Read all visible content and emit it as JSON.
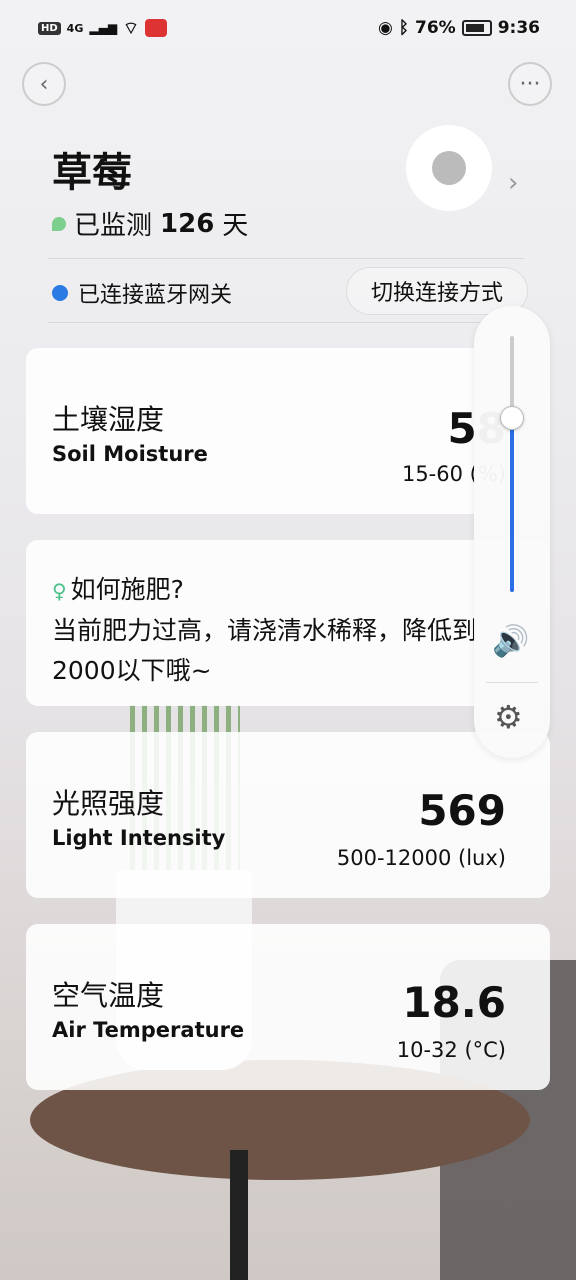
{
  "status_bar": {
    "left_chip": "HD",
    "network": "4G",
    "battery_pct": "76%",
    "time": "9:36"
  },
  "header": {
    "plant_name": "草莓",
    "monitored_prefix": "已监测",
    "monitored_days": "126",
    "days_unit": "天"
  },
  "connection": {
    "status": "已连接蓝牙网关",
    "switch_label": "切换连接方式"
  },
  "soil": {
    "cn": "土壤湿度",
    "en": "Soil Moisture",
    "value": "58",
    "range": "15-60 (%)"
  },
  "tip": {
    "title": "如何施肥?",
    "text": "当前肥力过高，请浇清水稀释，降低到2000以下哦~"
  },
  "light": {
    "cn": "光照强度",
    "en": "Light Intensity",
    "value": "569",
    "range": "500-12000 (lux)"
  },
  "air": {
    "cn": "空气温度",
    "en": "Air Temperature",
    "value": "18.6",
    "range": "10-32 (°C)"
  },
  "volume": {
    "level": 0.68
  },
  "icons": {
    "back": "back-icon",
    "more": "more-icon",
    "avatar": "plant-avatar-icon",
    "chevron": "chevron-right-icon",
    "bluetooth": "bluetooth-icon",
    "bulb": "lightbulb-icon",
    "speaker": "speaker-icon",
    "gear": "gear-icon"
  }
}
